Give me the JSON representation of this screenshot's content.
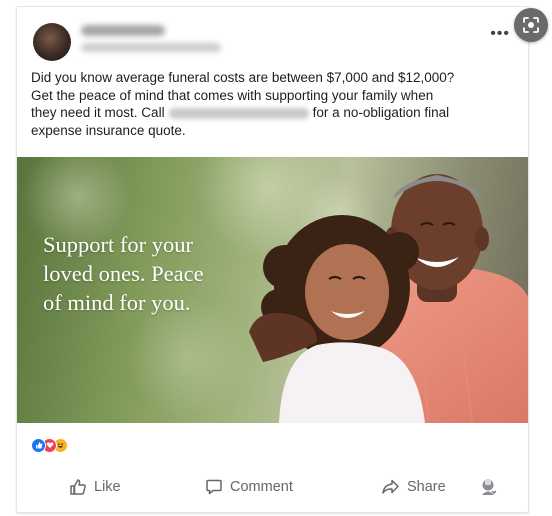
{
  "post": {
    "text_line1": "Did you know average funeral costs are between $7,000 and $12,000?",
    "text_line2": "Get the peace of mind that comes with supporting your family when",
    "text_line3_a": "they need it most. Call",
    "text_line3_b": "for a no-obligation final",
    "text_line4": "expense insurance quote."
  },
  "image": {
    "overlay_text": "Support for your\nloved ones. Peace\nof mind for you."
  },
  "reactions": {
    "icons": [
      "like-reaction-icon",
      "love-reaction-icon",
      "haha-reaction-icon"
    ],
    "colors": {
      "like": "#1877f2",
      "love": "#f33e58",
      "haha": "#f7b125"
    }
  },
  "actions": {
    "like_label": "Like",
    "comment_label": "Comment",
    "share_label": "Share"
  },
  "theme": {
    "text_color": "#1c1e21",
    "secondary_text": "#65676b"
  }
}
